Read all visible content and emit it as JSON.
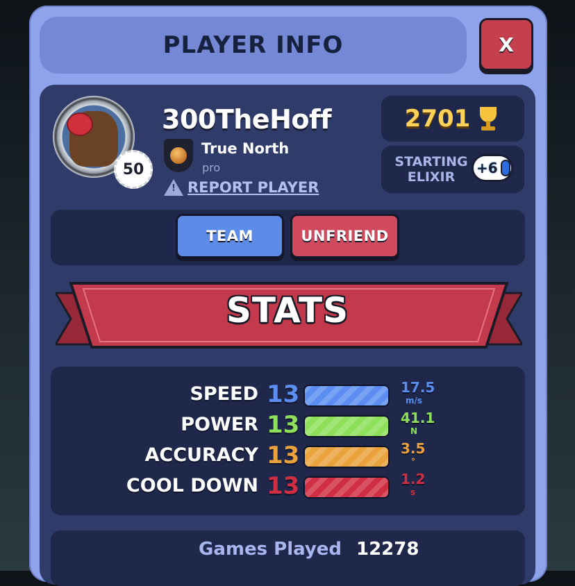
{
  "header": {
    "title": "PLAYER INFO",
    "close_label": "X"
  },
  "player": {
    "name": "300TheHoff",
    "level": "50",
    "clan_name": "True North",
    "clan_role": "pro",
    "report_label": "REPORT PLAYER"
  },
  "trophies": {
    "value": "2701",
    "icon": "trophy-icon"
  },
  "elixir": {
    "label_line1": "STARTING",
    "label_line2": "ELIXIR",
    "value": "+6"
  },
  "actions": {
    "team_label": "TEAM",
    "unfriend_label": "UNFRIEND"
  },
  "stats": {
    "banner": "STATS",
    "rows": [
      {
        "label": "SPEED",
        "level": "13",
        "value": "17.5",
        "unit": "m/s",
        "color": "#5b8ef0",
        "fill": 1.0
      },
      {
        "label": "POWER",
        "level": "13",
        "value": "41.1",
        "unit": "N",
        "color": "#8ee05a",
        "fill": 1.0
      },
      {
        "label": "ACCURACY",
        "level": "13",
        "value": "3.5",
        "unit": "°",
        "color": "#e9a23c",
        "fill": 1.0
      },
      {
        "label": "COOL DOWN",
        "level": "13",
        "value": "1.2",
        "unit": "s",
        "color": "#d02e43",
        "fill": 1.0
      }
    ]
  },
  "games": {
    "label": "Games Played",
    "value": "12278"
  },
  "colors": {
    "panel": "#8ea3ec",
    "inner": "#2f3c6a",
    "box": "#1f284b",
    "team_button": "#5c8ce8",
    "unfriend_button": "#cf4a5d",
    "ribbon": "#c43a4d"
  }
}
